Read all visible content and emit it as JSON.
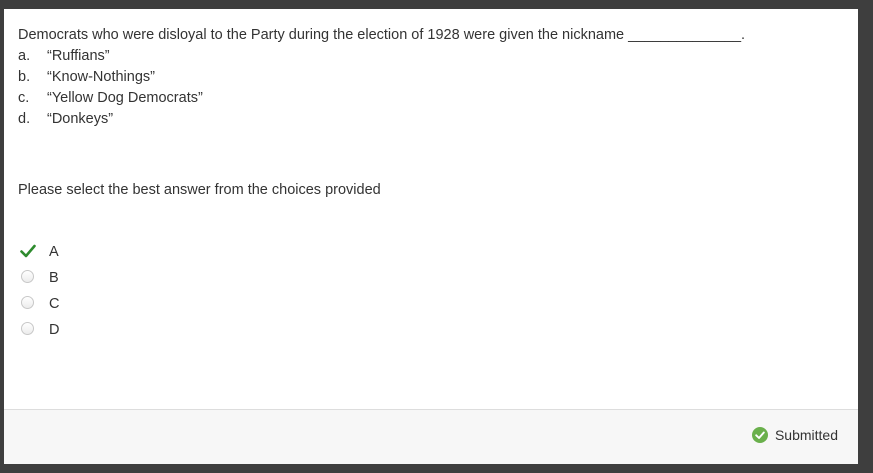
{
  "question": {
    "text": "Democrats who were disloyal to the Party during the election of 1928 were given the nickname ______________.",
    "options": [
      {
        "letter": "a.",
        "text": "“Ruffians”"
      },
      {
        "letter": "b.",
        "text": "“Know-Nothings”"
      },
      {
        "letter": "c.",
        "text": "“Yellow Dog Democrats”"
      },
      {
        "letter": "d.",
        "text": "“Donkeys”"
      }
    ]
  },
  "instruction": "Please select the best answer from the choices provided",
  "answers": [
    {
      "label": "A",
      "selected": true
    },
    {
      "label": "B",
      "selected": false
    },
    {
      "label": "C",
      "selected": false
    },
    {
      "label": "D",
      "selected": false
    }
  ],
  "footer": {
    "status": "Submitted",
    "status_icon": "check-circle-icon"
  },
  "colors": {
    "check_green": "#2e8b2e",
    "status_green": "#6ab04c"
  }
}
